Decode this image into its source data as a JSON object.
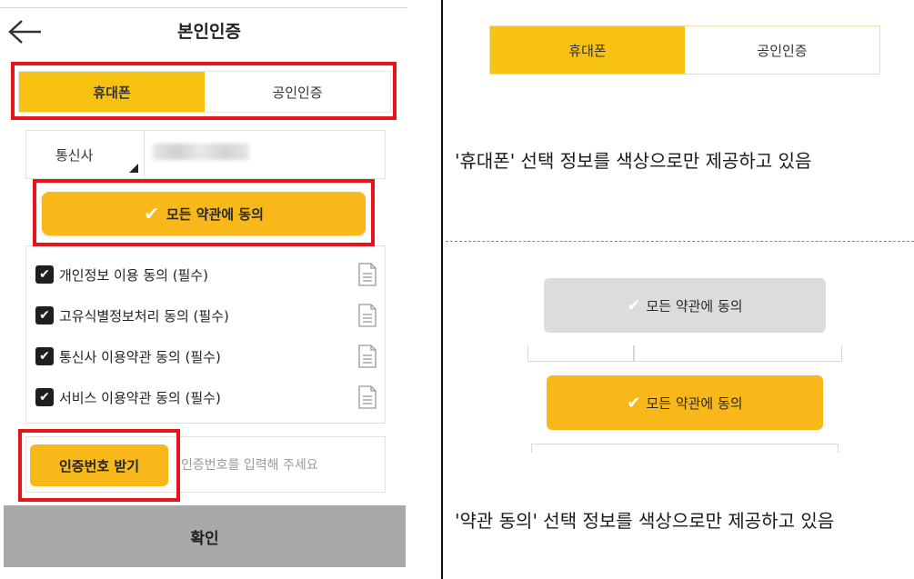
{
  "header": {
    "title": "본인인증"
  },
  "auth_tabs": [
    {
      "label": "휴대폰",
      "active": true
    },
    {
      "label": "공인인증",
      "active": false
    }
  ],
  "carrier": {
    "label": "통신사"
  },
  "agree_all": {
    "label": "모든 약관에 동의"
  },
  "terms": [
    {
      "label": "개인정보 이용 동의 (필수)",
      "checked": true
    },
    {
      "label": "고유식별정보처리 동의 (필수)",
      "checked": true
    },
    {
      "label": "통신사 이용약관 동의 (필수)",
      "checked": true
    },
    {
      "label": "서비스 이용약관 동의 (필수)",
      "checked": true
    }
  ],
  "verification": {
    "button_label": "인증번호 받기",
    "placeholder": "인증번호를 입력해 주세요"
  },
  "confirm": {
    "label": "확인"
  },
  "example_tabs": [
    {
      "label": "휴대폰",
      "active": true
    },
    {
      "label": "공인인증",
      "active": false
    }
  ],
  "caption_tabs": "'휴대폰' 선택 정보를 색상으로만 제공하고 있음",
  "example_agree": {
    "unselected_label": "모든 약관에 동의",
    "selected_label": "모든 약관에 동의"
  },
  "caption_agree": "'약관 동의' 선택 정보를 색상으로만 제공하고 있음",
  "colors": {
    "accent_yellow": "#f8b81a",
    "tab_yellow": "#f8c213",
    "highlight_red": "#e8141c",
    "confirm_grey": "#a9a9a9",
    "unselected_grey": "#dcdcdc"
  }
}
